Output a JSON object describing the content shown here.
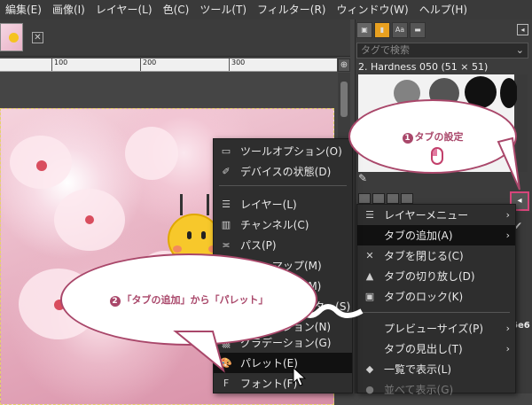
{
  "menubar": {
    "items": [
      "編集(E)",
      "画像(I)",
      "レイヤー(L)",
      "色(C)",
      "ツール(T)",
      "フィルター(R)",
      "ウィンドウ(W)",
      "ヘルプ(H)"
    ]
  },
  "ruler": {
    "ticks": [
      "100",
      "200",
      "300"
    ]
  },
  "right_panel": {
    "tabs": [
      "▣",
      "▮",
      "Aa",
      "▬"
    ],
    "tag_placeholder": "タグで検索",
    "brush_name": "2. Hardness 050 (51 × 51)",
    "lower_number": "6e6"
  },
  "tab_menu": {
    "items": [
      {
        "label": "レイヤーメニュー",
        "icon": "layers-icon",
        "arrow": true
      },
      {
        "label": "タブの追加(A)",
        "icon": "",
        "arrow": true,
        "highlight": true
      },
      {
        "label": "タブを閉じる(C)",
        "icon": "close-x-icon"
      },
      {
        "label": "タブの切り放し(D)",
        "icon": "detach-icon"
      },
      {
        "label": "タブのロック(K)",
        "icon": "lock-icon"
      },
      {
        "label": "プレビューサイズ(P)",
        "icon": "",
        "arrow": true
      },
      {
        "label": "タブの見出し(T)",
        "icon": "",
        "arrow": true
      },
      {
        "label": "一覧で表示(L)",
        "icon": "radio-selected-icon"
      },
      {
        "label": "並べて表示(G)",
        "icon": "radio-icon"
      }
    ]
  },
  "add_tab_menu": {
    "items": [
      {
        "label": "ツールオプション(O)",
        "icon": "tool-options-icon"
      },
      {
        "label": "デバイスの状態(D)",
        "icon": "device-status-icon"
      },
      {
        "label": "レイヤー(L)",
        "icon": "layers-icon"
      },
      {
        "label": "チャンネル(C)",
        "icon": "channels-icon"
      },
      {
        "label": "パス(P)",
        "icon": "paths-icon"
      },
      {
        "label": "カラーマップ(M)",
        "icon": "colormap-icon"
      },
      {
        "label": "ヒストグラム(M)",
        "icon": "histogram-icon"
      },
      {
        "label": "選択範囲エディター(S)",
        "icon": "selection-editor-icon"
      },
      {
        "label": "ナビゲーション(N)",
        "icon": "navigation-icon"
      },
      {
        "label": "グラデーション(G)",
        "icon": "gradient-icon"
      },
      {
        "label": "パレット(E)",
        "icon": "palette-icon",
        "highlight": true
      },
      {
        "label": "フォント(F)",
        "icon": "font-icon"
      }
    ]
  },
  "callouts": {
    "one": {
      "num": "1",
      "text": "タブの設定"
    },
    "two": {
      "num": "2",
      "text": "「タブの追加」から「パレット」"
    }
  },
  "colors": {
    "accent": "#a9476a",
    "highlight_border": "#d6457a"
  }
}
